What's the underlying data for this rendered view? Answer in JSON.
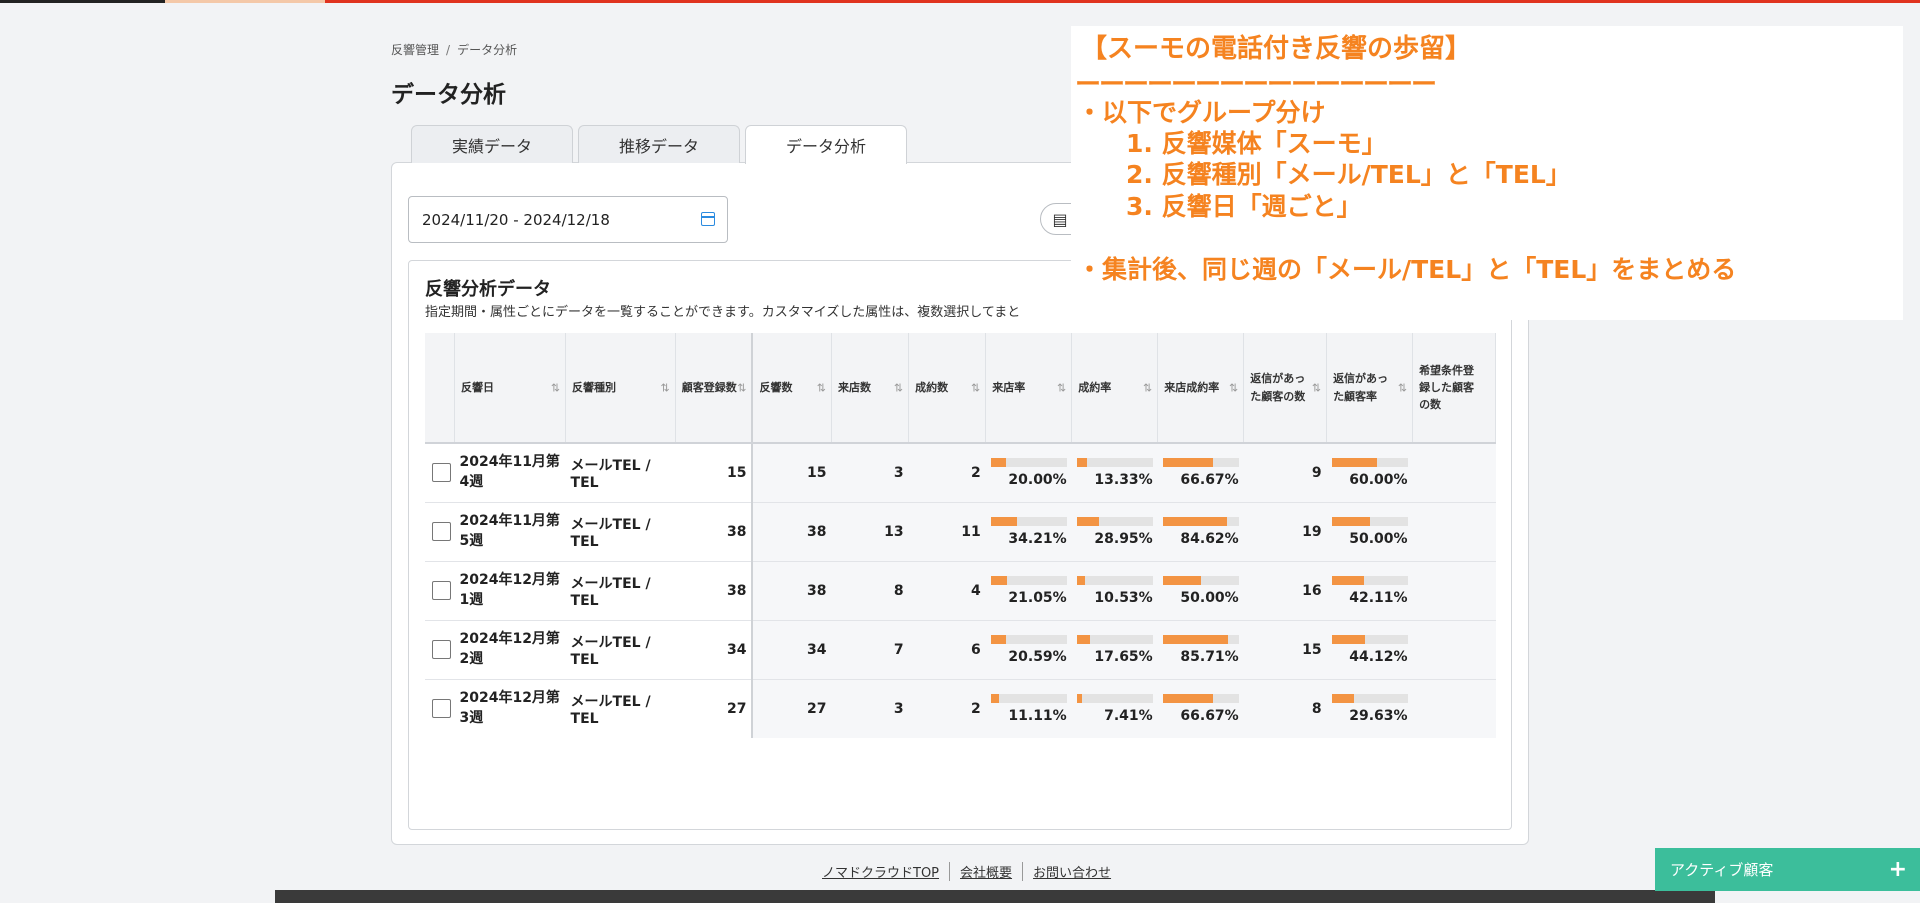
{
  "breadcrumb": {
    "parent": "反響管理",
    "separator": "/",
    "current": "データ分析"
  },
  "page_title": "データ分析",
  "tabs": [
    {
      "label": "実績データ",
      "active": false
    },
    {
      "label": "推移データ",
      "active": false
    },
    {
      "label": "データ分析",
      "active": true
    }
  ],
  "date_range": {
    "value": "2024/11/20 - 2024/12/18",
    "icon": "calendar-icon"
  },
  "panel": {
    "title": "反響分析データ",
    "description": "指定期間・属性ごとにデータを一覧することができます。カスタマイズした属性は、複数選択してまと"
  },
  "table": {
    "columns": [
      {
        "label": "反響日"
      },
      {
        "label": "反響種別"
      },
      {
        "label": "顧客登録数"
      },
      {
        "label": "反響数"
      },
      {
        "label": "来店数"
      },
      {
        "label": "成約数"
      },
      {
        "label": "来店率"
      },
      {
        "label": "成約率"
      },
      {
        "label": "来店成約率"
      },
      {
        "label": "返信があった顧客の数"
      },
      {
        "label": "返信があった顧客率"
      },
      {
        "label": "希望条件登録した顧客の数"
      }
    ],
    "rows": [
      {
        "date": "2024年11月第4週",
        "type": "メールTEL / TEL",
        "registered": "15",
        "responses": "15",
        "visits": "3",
        "contracts": "2",
        "visit_rate": "20.00%",
        "visit_rate_v": 0.2,
        "contract_rate": "13.33%",
        "contract_rate_v": 0.1333,
        "visit_contract_rate": "66.67%",
        "visit_contract_rate_v": 0.6667,
        "replied": "9",
        "replied_rate": "60.00%",
        "replied_rate_v": 0.6
      },
      {
        "date": "2024年11月第5週",
        "type": "メールTEL / TEL",
        "registered": "38",
        "responses": "38",
        "visits": "13",
        "contracts": "11",
        "visit_rate": "34.21%",
        "visit_rate_v": 0.3421,
        "contract_rate": "28.95%",
        "contract_rate_v": 0.2895,
        "visit_contract_rate": "84.62%",
        "visit_contract_rate_v": 0.8462,
        "replied": "19",
        "replied_rate": "50.00%",
        "replied_rate_v": 0.5
      },
      {
        "date": "2024年12月第1週",
        "type": "メールTEL / TEL",
        "registered": "38",
        "responses": "38",
        "visits": "8",
        "contracts": "4",
        "visit_rate": "21.05%",
        "visit_rate_v": 0.2105,
        "contract_rate": "10.53%",
        "contract_rate_v": 0.1053,
        "visit_contract_rate": "50.00%",
        "visit_contract_rate_v": 0.5,
        "replied": "16",
        "replied_rate": "42.11%",
        "replied_rate_v": 0.4211
      },
      {
        "date": "2024年12月第2週",
        "type": "メールTEL / TEL",
        "registered": "34",
        "responses": "34",
        "visits": "7",
        "contracts": "6",
        "visit_rate": "20.59%",
        "visit_rate_v": 0.2059,
        "contract_rate": "17.65%",
        "contract_rate_v": 0.1765,
        "visit_contract_rate": "85.71%",
        "visit_contract_rate_v": 0.8571,
        "replied": "15",
        "replied_rate": "44.12%",
        "replied_rate_v": 0.4412
      },
      {
        "date": "2024年12月第3週",
        "type": "メールTEL / TEL",
        "registered": "27",
        "responses": "27",
        "visits": "3",
        "contracts": "2",
        "visit_rate": "11.11%",
        "visit_rate_v": 0.1111,
        "contract_rate": "7.41%",
        "contract_rate_v": 0.0741,
        "visit_contract_rate": "66.67%",
        "visit_contract_rate_v": 0.6667,
        "replied": "8",
        "replied_rate": "29.63%",
        "replied_rate_v": 0.2963
      }
    ]
  },
  "footer": {
    "links": [
      "ノマドクラウドTOP",
      "会社概要",
      "お問い合わせ"
    ]
  },
  "active_customer": {
    "label": "アクティブ顧客",
    "icon": "plus-icon"
  },
  "annotation": {
    "title": "【スーモの電話付き反響の歩留】",
    "rule": "ーーーーーーーーーーーーーーー",
    "line1": "・以下でグループ分け",
    "line2": "1. 反響媒体「スーモ」",
    "line3": "2. 反響種別「メール/TEL」と「TEL」",
    "line4": "3. 反響日「週ごと」",
    "line5": "・集計後、同じ週の「メール/TEL」と「TEL」をまとめる"
  },
  "colors": {
    "accent": "#f39443",
    "annotation": "#f58320",
    "active_customer": "#3cbe9b",
    "top_bar": "#e0331f"
  }
}
